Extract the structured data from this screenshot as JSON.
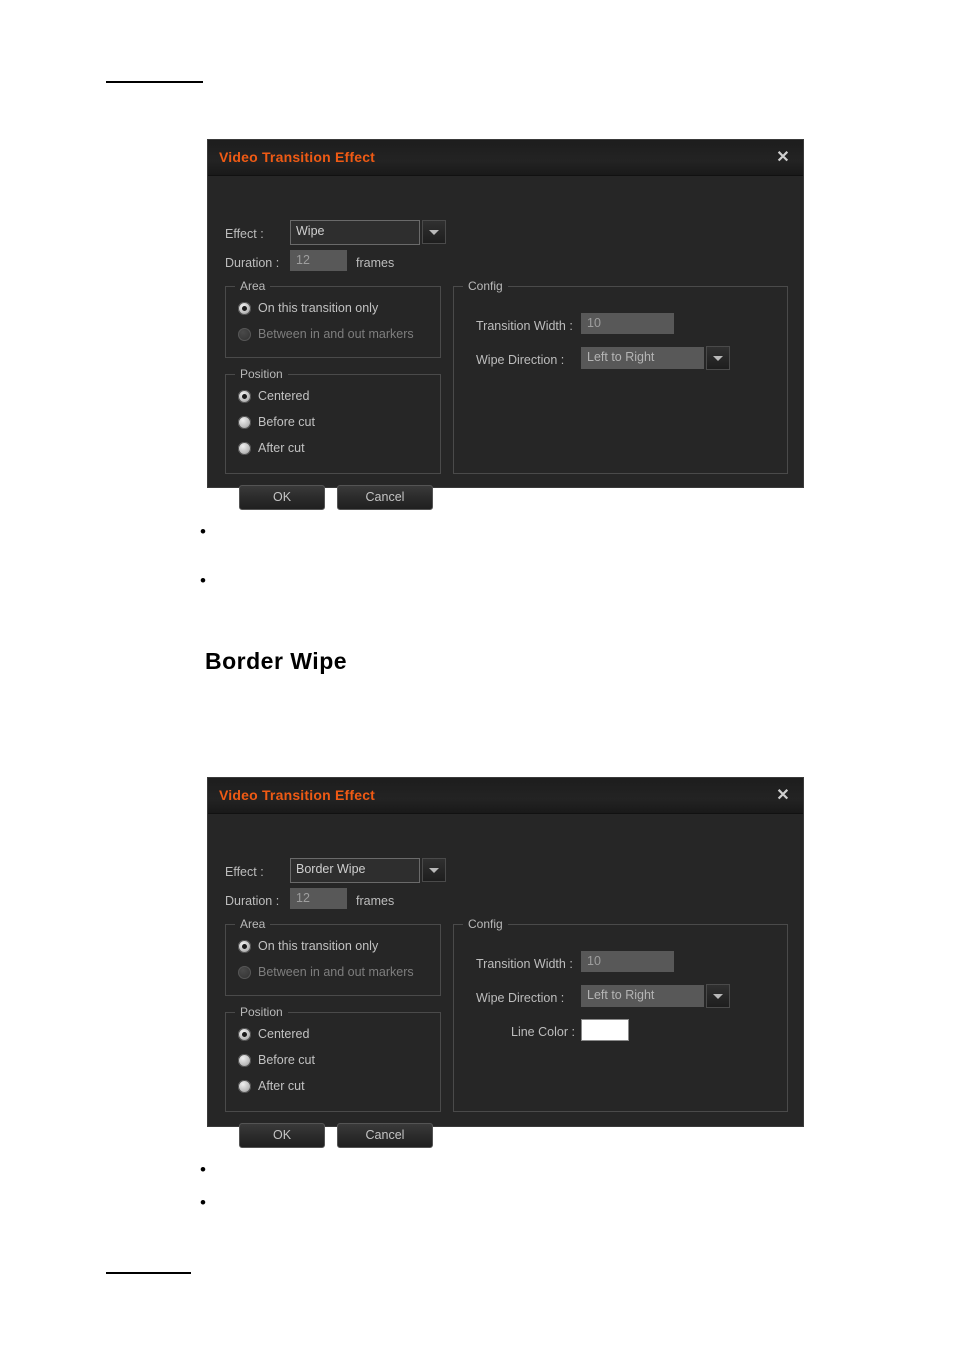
{
  "document": {
    "heading": "Border  Wipe",
    "bullets_group_one": [
      "",
      ""
    ],
    "bullets_group_two": [
      "",
      ""
    ]
  },
  "colors": {
    "title_accent": "#ef5a14",
    "dialog_background": "#262626",
    "field_background": "#585858",
    "line_color_swatch": "#ffffff"
  },
  "dialog_wipe": {
    "title": "Video Transition Effect",
    "close_icon": "close-icon",
    "effect_label": "Effect :",
    "effect_value": "Wipe",
    "effect_dropdown_icon": "chevron-down-icon",
    "duration_label": "Duration :",
    "duration_value": "12",
    "duration_units": "frames",
    "area": {
      "title": "Area",
      "options": [
        {
          "label": "On this transition only",
          "selected": true,
          "disabled": false
        },
        {
          "label": "Between in and out markers",
          "selected": false,
          "disabled": true
        }
      ]
    },
    "position": {
      "title": "Position",
      "options": [
        {
          "label": "Centered",
          "selected": true
        },
        {
          "label": "Before cut",
          "selected": false
        },
        {
          "label": "After cut",
          "selected": false
        }
      ]
    },
    "config": {
      "title": "Config",
      "transition_width_label": "Transition Width :",
      "transition_width_value": "10",
      "wipe_direction_label": "Wipe Direction :",
      "wipe_direction_value": "Left to Right",
      "wipe_direction_icon": "chevron-down-icon"
    },
    "ok_label": "OK",
    "cancel_label": "Cancel"
  },
  "dialog_border_wipe": {
    "title": "Video Transition Effect",
    "close_icon": "close-icon",
    "effect_label": "Effect :",
    "effect_value": "Border Wipe",
    "effect_dropdown_icon": "chevron-down-icon",
    "duration_label": "Duration :",
    "duration_value": "12",
    "duration_units": "frames",
    "area": {
      "title": "Area",
      "options": [
        {
          "label": "On this transition only",
          "selected": true,
          "disabled": false
        },
        {
          "label": "Between in and out markers",
          "selected": false,
          "disabled": true
        }
      ]
    },
    "position": {
      "title": "Position",
      "options": [
        {
          "label": "Centered",
          "selected": true
        },
        {
          "label": "Before cut",
          "selected": false
        },
        {
          "label": "After cut",
          "selected": false
        }
      ]
    },
    "config": {
      "title": "Config",
      "transition_width_label": "Transition Width :",
      "transition_width_value": "10",
      "wipe_direction_label": "Wipe Direction :",
      "wipe_direction_value": "Left to Right",
      "wipe_direction_icon": "chevron-down-icon",
      "line_color_label": "Line Color :",
      "line_color_value": "#ffffff"
    },
    "ok_label": "OK",
    "cancel_label": "Cancel"
  }
}
